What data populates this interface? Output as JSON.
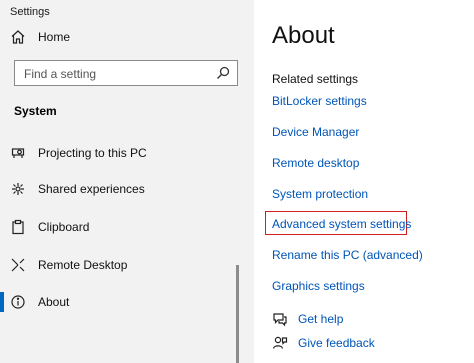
{
  "window": {
    "title": "Settings"
  },
  "sidebar": {
    "home_label": "Home",
    "search": {
      "placeholder": "Find a setting",
      "icon": "search-icon"
    },
    "section_title": "System",
    "items": [
      {
        "label": "Projecting to this PC",
        "icon": "projector-icon"
      },
      {
        "label": "Shared experiences",
        "icon": "shared-experiences-icon"
      },
      {
        "label": "Clipboard",
        "icon": "clipboard-icon"
      },
      {
        "label": "Remote Desktop",
        "icon": "remote-desktop-icon"
      },
      {
        "label": "About",
        "icon": "info-icon",
        "selected": true
      }
    ],
    "accent_color": "#0067c0"
  },
  "main": {
    "title": "About",
    "related_heading": "Related settings",
    "links": [
      "BitLocker settings",
      "Device Manager",
      "Remote desktop",
      "System protection",
      "Advanced system settings",
      "Rename this PC (advanced)",
      "Graphics settings"
    ],
    "highlighted_link": "Advanced system settings",
    "highlight_color": "#d11f1f",
    "help_links": [
      {
        "label": "Get help",
        "icon": "help-chat-icon"
      },
      {
        "label": "Give feedback",
        "icon": "feedback-icon"
      }
    ]
  }
}
